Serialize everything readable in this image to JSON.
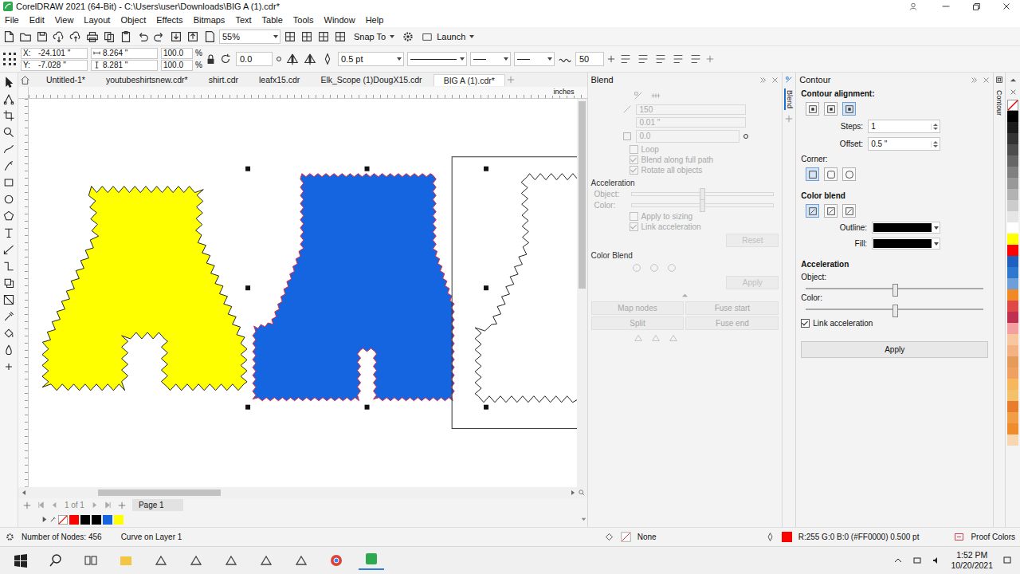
{
  "window": {
    "title": "CorelDRAW 2021 (64-Bit) - C:\\Users\\user\\Downloads\\BIG A (1).cdr*"
  },
  "menu": [
    "File",
    "Edit",
    "View",
    "Layout",
    "Object",
    "Effects",
    "Bitmaps",
    "Text",
    "Table",
    "Tools",
    "Window",
    "Help"
  ],
  "toolbar": {
    "zoom": "55%",
    "snap": "Snap To",
    "launch": "Launch"
  },
  "property_bar": {
    "x_label": "X:",
    "x": "-24.101 \"",
    "y_label": "Y:",
    "y": "-7.028 \"",
    "width": "8.264 \"",
    "height": "8.281 \"",
    "scale": [
      {
        "value": "100.0",
        "unit": "%"
      },
      {
        "value": "100.0",
        "unit": "%"
      }
    ],
    "rotation": "0.0",
    "outline": "0.5 pt",
    "smoothing": "50"
  },
  "tabs": [
    {
      "label": "Untitled-1*",
      "selected": false
    },
    {
      "label": "youtubeshirtsnew.cdr*",
      "selected": false
    },
    {
      "label": "shirt.cdr",
      "selected": false
    },
    {
      "label": "leafx15.cdr",
      "selected": false
    },
    {
      "label": "Elk_Scope (1)DougX15.cdr",
      "selected": false
    },
    {
      "label": "BIG A (1).cdr*",
      "selected": true
    }
  ],
  "ruler_unit": "inches",
  "canvas": {
    "shapes": [
      {
        "color": "#ffff00",
        "outline": "#222222",
        "selected": false
      },
      {
        "color": "#1565e0",
        "outline": "#e8283c",
        "selected": true
      },
      {
        "color": "none",
        "outline": "#222222",
        "selected": false
      }
    ]
  },
  "pages": {
    "count": "1 of 1",
    "tab": "Page 1"
  },
  "document_palette": [
    {
      "color": "none"
    },
    {
      "color": "#ff0000"
    },
    {
      "color": "#000000"
    },
    {
      "color": "#000000"
    },
    {
      "color": "#1565e0"
    },
    {
      "color": "#ffff00"
    }
  ],
  "blend": {
    "title": "Blend",
    "steps": "150",
    "spacing": "0.01 \"",
    "rotation": "0.0",
    "disabled": true,
    "options": [
      {
        "label": "Loop",
        "checked": false
      },
      {
        "label": "Blend along full path",
        "checked": true
      },
      {
        "label": "Rotate all objects",
        "checked": true
      }
    ],
    "acceleration": "Acceleration",
    "sliders": [
      {
        "label": "Object:",
        "level": 0.5
      },
      {
        "label": "Color:",
        "level": 0.5
      }
    ],
    "accel_options": [
      {
        "label": "Apply to sizing",
        "checked": false
      },
      {
        "label": "Link acceleration",
        "checked": true
      }
    ],
    "reset": "Reset",
    "color_blend": "Color Blend",
    "apply": "Apply",
    "buttons": [
      "Map nodes",
      "Fuse start",
      "Split",
      "Fuse end"
    ]
  },
  "side_tabs": [
    {
      "label": "Blend"
    },
    {
      "label": "Contour"
    }
  ],
  "contour": {
    "title": "Contour",
    "alignment_label": "Contour alignment:",
    "alignment": [
      {
        "selected": false
      },
      {
        "selected": false
      },
      {
        "selected": true
      }
    ],
    "steps_label": "Steps:",
    "steps": "1",
    "offset_label": "Offset:",
    "offset": "0.5 \"",
    "corner_label": "Corner:",
    "corners": [
      {
        "selected": true
      },
      {
        "selected": false
      },
      {
        "selected": false
      }
    ],
    "color_blend_label": "Color blend",
    "color_modes": [
      {
        "selected": true
      },
      {
        "selected": false
      },
      {
        "selected": false
      }
    ],
    "outline_label": "Outline:",
    "outline_color": "#000000",
    "fill_label": "Fill:",
    "fill_color": "#000000",
    "acceleration": "Acceleration",
    "sliders": [
      {
        "label": "Object:",
        "level": 0.5
      },
      {
        "label": "Color:",
        "level": 0.5
      }
    ],
    "link": {
      "label": "Link acceleration",
      "checked": true
    },
    "apply": "Apply"
  },
  "palette": [
    {
      "color": "#000000"
    },
    {
      "color": "#1a1a1a"
    },
    {
      "color": "#333333"
    },
    {
      "color": "#4d4d4d"
    },
    {
      "color": "#666666"
    },
    {
      "color": "#808080"
    },
    {
      "color": "#999999"
    },
    {
      "color": "#b3b3b3"
    },
    {
      "color": "#cccccc"
    },
    {
      "color": "#e6e6e6"
    },
    {
      "color": "#ffffff"
    },
    {
      "color": "#ffff00"
    },
    {
      "color": "#ff0000"
    },
    {
      "color": "#1f5fbf"
    },
    {
      "color": "#2f78d0"
    },
    {
      "color": "#6f9fd8"
    },
    {
      "color": "#f08a24"
    },
    {
      "color": "#e04848"
    },
    {
      "color": "#c03050"
    },
    {
      "color": "#f4a0a0"
    },
    {
      "color": "#f7c8a0"
    },
    {
      "color": "#f4b183"
    },
    {
      "color": "#e59b5a"
    },
    {
      "color": "#f0a060"
    },
    {
      "color": "#f7b75d"
    },
    {
      "color": "#f4c06a"
    },
    {
      "color": "#e87d2e"
    },
    {
      "color": "#f19e47"
    },
    {
      "color": "#ef8c2b"
    },
    {
      "color": "#f6d7b0"
    }
  ],
  "status_bar": {
    "nodes": "Number of Nodes: 456",
    "object": "Curve on Layer 1",
    "fill": "None",
    "outline": "R:255 G:0 B:0 (#FF0000) 0.500 pt",
    "outline_color": "#ff0000",
    "proof": "Proof Colors"
  },
  "taskbar": {
    "time": "1:52 PM",
    "date": "10/20/2021"
  }
}
